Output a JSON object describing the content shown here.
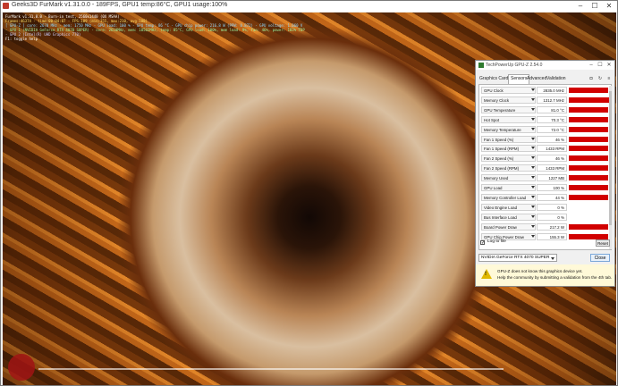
{
  "furmark": {
    "title": "Geeks3D FurMark v1.31.0.0 - 189FPS, GPU1 temp:86°C, GPU1 usage:100%",
    "window_controls": {
      "minimize": "–",
      "maximize": "☐",
      "close": "✕"
    },
    "osd_lines": [
      "FurMark v1.31.0.0 - Burn-in test, 2560x1440 (0X MSAA)",
      "Frames:46374 - time:00:04:07 - FPS:189 (min:155, max:210, avg:188)",
      "[ GPU-Z ] core: 2670 MHz - mem: 1750 MHz - GPU load: 100 % - GPU temp: 86 °C - GPU chip power: 216.8 W (PPW: 0.872) - GPU voltage: 1.060 V",
      "- GPU 1 (NVIDIA GeForce RTX 4070 SUPER) - core: 2610MHz, mem: 10502MHz, temp: 85°C, GPU load: 100%, mem load: 9%, fan: 46%, power: 103% TDP",
      "- GPU 2 (Intel(R) UHD Graphics 770)",
      "F1: toggle help"
    ]
  },
  "gpuz": {
    "title": "TechPowerUp GPU-Z 2.54.0",
    "window_controls": {
      "minimize": "–",
      "maximize": "☐",
      "close": "✕"
    },
    "tabs": [
      "Graphics Card",
      "Sensors",
      "Advanced",
      "Validation"
    ],
    "active_tab": "Sensors",
    "tools": {
      "camera": "◘",
      "refresh": "↻",
      "menu": "≡"
    },
    "sensors": [
      {
        "name": "GPU Clock",
        "value": "2835.0 MHz",
        "level": 0.95
      },
      {
        "name": "Memory Clock",
        "value": "1312.7 MHz",
        "level": 1.0
      },
      {
        "name": "GPU Temperature",
        "value": "81.0 °C",
        "level": 0.95
      },
      {
        "name": "Hot Spot",
        "value": "70.3 °C",
        "level": 0.95
      },
      {
        "name": "Memory Temperature",
        "value": "72.0 °C",
        "level": 0.95
      },
      {
        "name": "Fan 1 Speed (%)",
        "value": "46 %",
        "level": 0.95
      },
      {
        "name": "Fan 1 Speed (RPM)",
        "value": "1433 RPM",
        "level": 0.95
      },
      {
        "name": "Fan 2 Speed (%)",
        "value": "46 %",
        "level": 0.95
      },
      {
        "name": "Fan 2 Speed (RPM)",
        "value": "1433 RPM",
        "level": 0.95
      },
      {
        "name": "Memory Used",
        "value": "1227 MB",
        "level": 0.95
      },
      {
        "name": "GPU Load",
        "value": "100 %",
        "level": 0.95
      },
      {
        "name": "Memory Controller Load",
        "value": "44 %",
        "level": 0.95
      },
      {
        "name": "Video Engine Load",
        "value": "0 %",
        "level": 0.0
      },
      {
        "name": "Bus Interface Load",
        "value": "0 %",
        "level": 0.0
      },
      {
        "name": "Board Power Draw",
        "value": "217.2 W",
        "level": 0.95
      },
      {
        "name": "GPU Chip Power Draw",
        "value": "155.3 W",
        "level": 0.95
      }
    ],
    "log_label": "Log to file",
    "log_checked": "✓",
    "reset_label": "Reset",
    "selected_device": "NVIDIA GeForce RTX 4070 SUPER",
    "close_label": "Close",
    "notice_line1": "GPU-Z does not know this graphics device yet.",
    "notice_line2": "Help the community by submitting a validation from the 4th tab.",
    "warn_mark": "!"
  }
}
